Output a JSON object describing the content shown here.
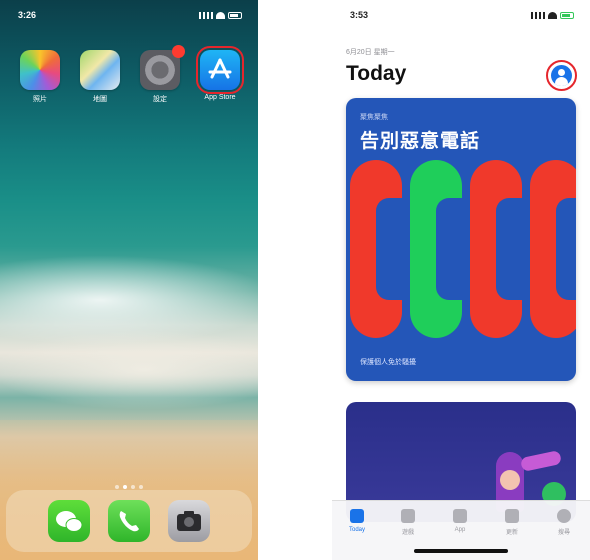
{
  "home_screen": {
    "status_time": "3:26",
    "apps": [
      {
        "label": "照片",
        "icon": "photos-icon"
      },
      {
        "label": "地圖",
        "icon": "maps-icon"
      },
      {
        "label": "設定",
        "icon": "settings-icon",
        "badge": true
      },
      {
        "label": "App Store",
        "icon": "app-store-icon",
        "highlighted": true
      }
    ],
    "dock": [
      "wechat-icon",
      "phone-icon",
      "camera-icon"
    ],
    "page_dots": 4,
    "active_dot": 1
  },
  "app_store": {
    "status_time": "3:53",
    "date": "6月20日 星期一",
    "title": "Today",
    "account_button": "account-icon",
    "card1": {
      "subtitle": "聚焦聚焦",
      "title": "告別惡意電話",
      "footer": "保護個人免於騷擾"
    },
    "tabs": [
      {
        "label": "Today",
        "active": true
      },
      {
        "label": "遊戲"
      },
      {
        "label": "App"
      },
      {
        "label": "更新"
      },
      {
        "label": "搜尋"
      }
    ]
  },
  "colors": {
    "highlight": "#e5262c",
    "accent": "#1a73e8",
    "card1_bg": "#2456b8"
  }
}
